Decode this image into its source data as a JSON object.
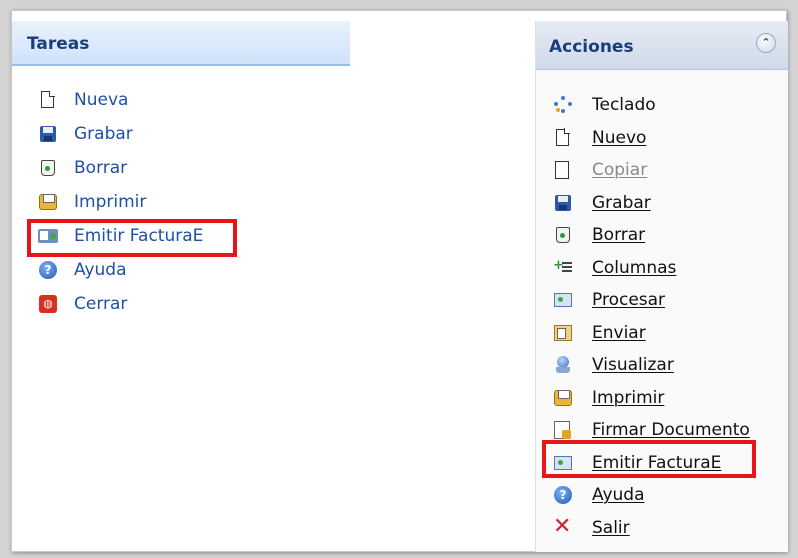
{
  "tareas": {
    "title": "Tareas",
    "items": [
      {
        "label": "Nueva",
        "icon": "new-document-icon"
      },
      {
        "label": "Grabar",
        "icon": "save-floppy-icon"
      },
      {
        "label": "Borrar",
        "icon": "recycle-bin-icon"
      },
      {
        "label": "Imprimir",
        "icon": "printer-icon"
      },
      {
        "label": "Emitir FacturaE",
        "icon": "invoice-icon"
      },
      {
        "label": "Ayuda",
        "icon": "help-icon"
      },
      {
        "label": "Cerrar",
        "icon": "close-power-icon"
      }
    ]
  },
  "acciones": {
    "title": "Acciones",
    "collapse_glyph": "⌃",
    "items": [
      {
        "label": "Teclado",
        "icon": "keyboard-icon"
      },
      {
        "label": "Nuevo",
        "icon": "new-document-icon"
      },
      {
        "label": "Copiar",
        "icon": "copy-icon"
      },
      {
        "label": "Grabar",
        "icon": "save-floppy-icon"
      },
      {
        "label": "Borrar",
        "icon": "recycle-bin-icon"
      },
      {
        "label": "Columnas",
        "icon": "columns-icon"
      },
      {
        "label": "Procesar",
        "icon": "process-icon"
      },
      {
        "label": "Enviar",
        "icon": "send-icon"
      },
      {
        "label": "Visualizar",
        "icon": "view-icon"
      },
      {
        "label": "Imprimir",
        "icon": "printer-icon"
      },
      {
        "label": "Firmar Documento",
        "icon": "sign-document-icon"
      },
      {
        "label": "Emitir FacturaE",
        "icon": "invoice-icon"
      },
      {
        "label": "Ayuda",
        "icon": "help-icon"
      },
      {
        "label": "Salir",
        "icon": "exit-x-icon"
      }
    ]
  },
  "colors": {
    "highlight": "#e8141c",
    "link_blue": "#1f4fa8",
    "header_title": "#1a3f7a"
  }
}
